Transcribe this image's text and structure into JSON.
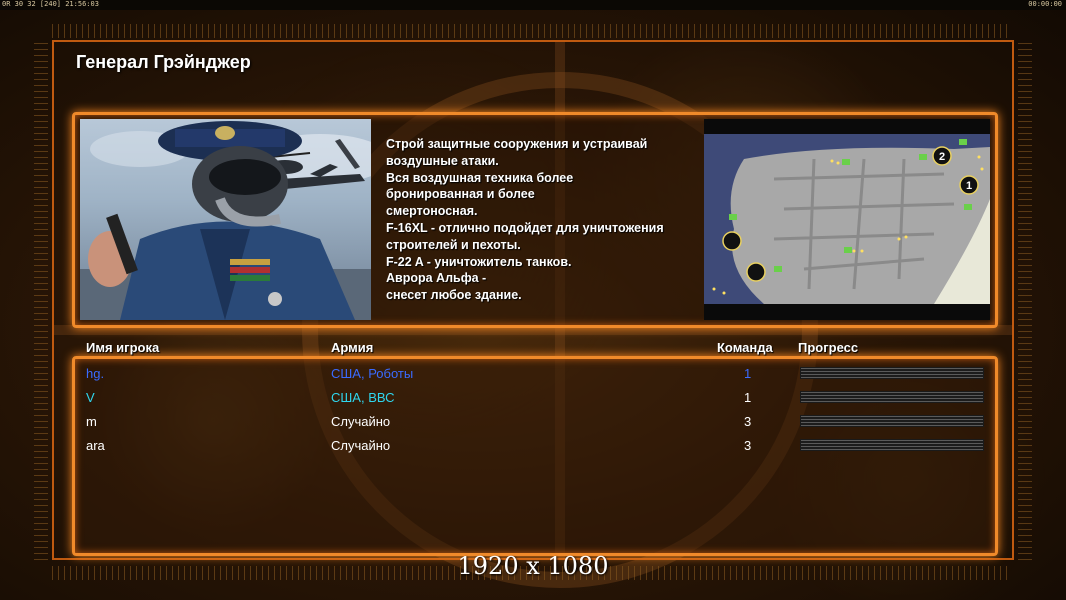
{
  "hud": {
    "left": "0R 30 32 [240] 21:56:03",
    "right": "00:00:00"
  },
  "general": {
    "name": "Генерал Грэйнджер"
  },
  "description": "Строй защитные сооружения и устраивай\n воздушные атаки.\nВся воздушная техника более\n бронированная и более\nсмертоносная.\nF-16XL - отлично подойдет для уничтожения\n строителей и пехоты.\nF-22 A - уничтожитель танков.\nАврора Альфа -\nснесет любое здание.",
  "minimap": {
    "markers": [
      "1",
      "2"
    ]
  },
  "table": {
    "headers": {
      "name": "Имя игрока",
      "army": "Армия",
      "team": "Команда",
      "progress": "Прогресс"
    },
    "rows": [
      {
        "name": "hg.",
        "army": "США, Роботы",
        "team": "1",
        "color": "#3a6bff"
      },
      {
        "name": "V",
        "army": "США, ВВС",
        "team": "1",
        "color": "#2fd6ee"
      },
      {
        "name": "m",
        "army": "Случайно",
        "team": "3",
        "color": "#ffffff"
      },
      {
        "name": "ara",
        "army": "Случайно",
        "team": "3",
        "color": "#ffffff"
      }
    ]
  },
  "resolution_label": "1920 x 1080",
  "colors": {
    "accent": "#f08a2a",
    "frame": "#c05a10"
  }
}
